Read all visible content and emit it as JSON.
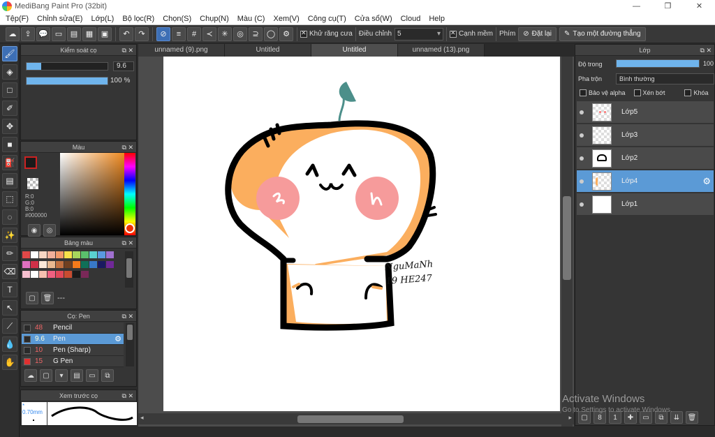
{
  "window": {
    "title": "MediBang Paint Pro (32bit)",
    "minimize": "—",
    "maximize": "❐",
    "close": "✕"
  },
  "menu": [
    "Tệp(F)",
    "Chỉnh sửa(E)",
    "Lớp(L)",
    "Bộ lọc(R)",
    "Chọn(S)",
    "Chụp(N)",
    "Màu (C)",
    "Xem(V)",
    "Công cụ(T)",
    "Cửa sổ(W)",
    "Cloud",
    "Help"
  ],
  "toolbar": {
    "antialias_label": "Khử răng cưa",
    "adjust_label": "Điều chỉnh",
    "adjust_value": "5",
    "edge_label": "Cạnh mềm",
    "key_label": "Phím",
    "reset_label": "Đặt lại",
    "straight_line_label": "Tạo một đường thẳng"
  },
  "brush_control": {
    "title": "Kiểm soát cọ",
    "size_value": "9.6",
    "size_fraction": 0.18,
    "opacity_value": "100 %",
    "opacity_fraction": 1.0
  },
  "color_panel": {
    "title": "Màu",
    "r": "R:0",
    "g": "G:0",
    "b": "B:0",
    "hex": "#000000"
  },
  "palette_panel": {
    "title": "Bảng màu",
    "swatches": [
      "#e04848",
      "#ffffff",
      "#f6d6c4",
      "#f2b09a",
      "#f39a6a",
      "#f6e04a",
      "#a7d65c",
      "#5ac06c",
      "#5ad0d0",
      "#5a9ae0",
      "#a070d0",
      "#e070c0",
      "#d03048",
      "#fce8d8",
      "#e8b890",
      "#c07040",
      "#704020",
      "#f47a1a",
      "#107058",
      "#3878c8",
      "#1a1a60",
      "#702898",
      "#f7c0d0",
      "#ffffff",
      "#f6c0b0",
      "#f06080",
      "#e04858",
      "#c84c30",
      "#1a1a1a",
      "#7a2858"
    ],
    "caption": "---"
  },
  "brush_panel": {
    "title": "Cọ: Pen",
    "items": [
      {
        "size": "48",
        "name": "Pencil",
        "color": "#2a2a2a"
      },
      {
        "size": "9.6",
        "name": "Pen",
        "color": "#2a2a2a"
      },
      {
        "size": "10",
        "name": "Pen (Sharp)",
        "color": "#2a2a2a"
      },
      {
        "size": "15",
        "name": "G Pen",
        "color": "#e03030"
      }
    ]
  },
  "preview_panel": {
    "title": "Xem trước cọ",
    "size_label": "* 0.70mm"
  },
  "tabs": [
    "unnamed (9).png",
    "Untitled",
    "Untitled",
    "unnamed (13).png"
  ],
  "layer_panel": {
    "title": "Lớp",
    "opacity_label": "Độ trong",
    "opacity_value": "100",
    "opacity_fraction": 1.0,
    "blend_label": "Pha trộn",
    "blend_value": "Bình thường",
    "protect_alpha": "Bảo vệ alpha",
    "clipping": "Xén bớt",
    "lock": "Khóa",
    "layers": [
      {
        "name": "Lớp5"
      },
      {
        "name": "Lớp3"
      },
      {
        "name": "Lớp2"
      },
      {
        "name": "Lớp4"
      },
      {
        "name": "Lớp1"
      }
    ]
  },
  "signature_text": "NguMaNh 19 HE247",
  "watermark": {
    "line1": "Activate Windows",
    "line2": "Go to Settings to activate Windows."
  }
}
